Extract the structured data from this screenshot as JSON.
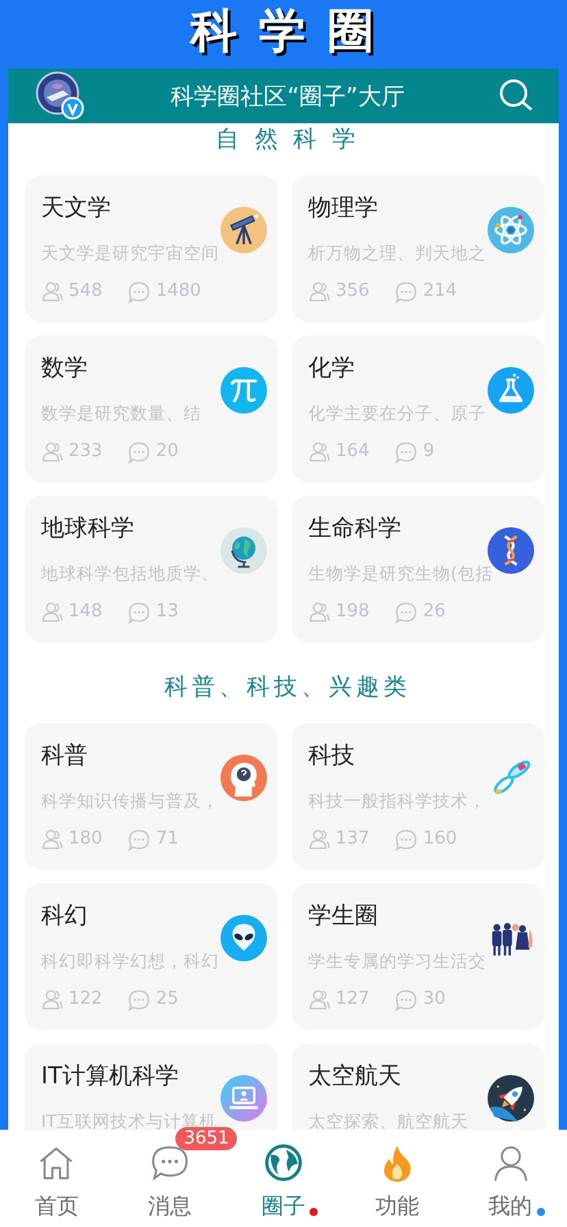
{
  "app_title": "科 学 圈",
  "header": {
    "title": "科学圈社区“圈子”大厅"
  },
  "sections": [
    {
      "heading": "自 然 科 学",
      "cards": [
        {
          "title": "天文学",
          "description": "天文学是研究宇宙空间",
          "members": "548",
          "posts": "1480"
        },
        {
          "title": "物理学",
          "description": "析万物之理、判天地之",
          "members": "356",
          "posts": "214"
        },
        {
          "title": "数学",
          "description": "数学是研究数量、结",
          "members": "233",
          "posts": "20"
        },
        {
          "title": "化学",
          "description": "化学主要在分子、原子",
          "members": "164",
          "posts": "9"
        },
        {
          "title": "地球科学",
          "description": "地球科学包括地质学、",
          "members": "148",
          "posts": "13"
        },
        {
          "title": "生命科学",
          "description": "生物学是研究生物(包括",
          "members": "198",
          "posts": "26"
        }
      ]
    },
    {
      "heading": "科普、科技、兴趣类",
      "cards": [
        {
          "title": "科普",
          "description": "科学知识传播与普及，",
          "members": "180",
          "posts": "71"
        },
        {
          "title": "科技",
          "description": "科技一般指科学技术，",
          "members": "137",
          "posts": "160"
        },
        {
          "title": "科幻",
          "description": "科幻即科学幻想，科幻",
          "members": "122",
          "posts": "25"
        },
        {
          "title": "学生圈",
          "description": "学生专属的学习生活交",
          "members": "127",
          "posts": "30"
        },
        {
          "title": "IT计算机科学",
          "description": "IT互联网技术与计算机"
        },
        {
          "title": "太空航天",
          "description": "太空探索、航空航天"
        }
      ]
    }
  ],
  "tab_bar": [
    {
      "label": "首页",
      "selected": false
    },
    {
      "label": "消息",
      "selected": false,
      "badge": "3651"
    },
    {
      "label": "圈子",
      "selected": true,
      "color": "#e8141e"
    },
    {
      "label": "功能",
      "selected": false
    },
    {
      "label": "我的",
      "selected": false,
      "color": "#2a8ef0"
    }
  ]
}
